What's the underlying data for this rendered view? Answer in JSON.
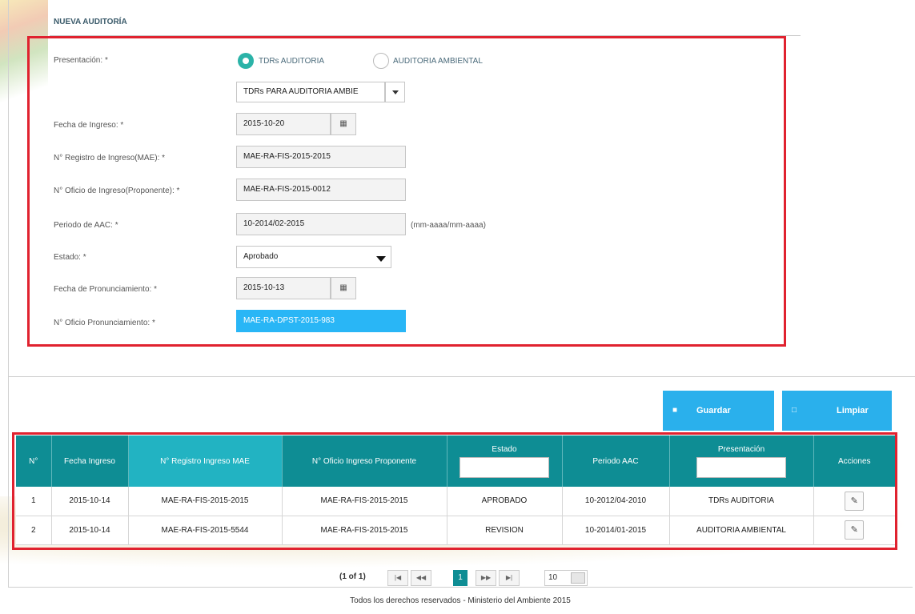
{
  "form": {
    "title": "NUEVA AUDITORÍA",
    "presentacion_label": "Presentación:",
    "radio_tdrs": "TDRs AUDITORIA",
    "radio_ambiental": "AUDITORIA AMBIENTAL",
    "presentacion_select": "TDRs PARA AUDITORIA AMBIE",
    "fecha_ingreso_label": "Fecha de Ingreso:",
    "fecha_ingreso_value": "2015-10-20",
    "registro_label": "N° Registro de Ingreso(MAE):",
    "registro_value": "MAE-RA-FIS-2015-2015",
    "oficio_label": "N° Oficio de Ingreso(Proponente):",
    "oficio_value": "MAE-RA-FIS-2015-0012",
    "periodo_label": "Periodo de AAC:",
    "periodo_value": "10-2014/02-2015",
    "periodo_hint": "(mm-aaaa/mm-aaaa)",
    "estado_label": "Estado:",
    "estado_value": "Aprobado",
    "fecha_pron_label": "Fecha de Pronunciamiento:",
    "fecha_pron_value": "2015-10-13",
    "oficio_pron_label": "N° Oficio Pronunciamiento:",
    "oficio_pron_value": "MAE-RA-DPST-2015-983",
    "required_mark": "*"
  },
  "buttons": {
    "guardar": "Guardar",
    "limpiar": "Limpiar"
  },
  "table": {
    "headers": {
      "num": "N°",
      "fecha": "Fecha Ingreso",
      "registro": "N° Registro Ingreso MAE",
      "oficio": "N° Oficio Ingreso Proponente",
      "estado": "Estado",
      "periodo": "Periodo AAC",
      "presentacion": "Presentación",
      "acciones": "Acciones"
    },
    "rows": [
      {
        "num": "1",
        "fecha": "2015-10-14",
        "registro": "MAE-RA-FIS-2015-2015",
        "oficio": "MAE-RA-FIS-2015-2015",
        "estado": "APROBADO",
        "periodo": "10-2012/04-2010",
        "presentacion": "TDRs AUDITORIA"
      },
      {
        "num": "2",
        "fecha": "2015-10-14",
        "registro": "MAE-RA-FIS-2015-5544",
        "oficio": "MAE-RA-FIS-2015-2015",
        "estado": "REVISION",
        "periodo": "10-2014/01-2015",
        "presentacion": "AUDITORIA AMBIENTAL"
      }
    ]
  },
  "pager": {
    "summary": "(1 of 1)",
    "current": "1",
    "rows_per_page": "10"
  },
  "footer": {
    "text": "Todos los derechos reservados - Ministerio del Ambiente 2015"
  },
  "colors": {
    "accent": "#2ab0ec",
    "header_teal": "#0e8d94",
    "highlight": "#e0222f"
  }
}
